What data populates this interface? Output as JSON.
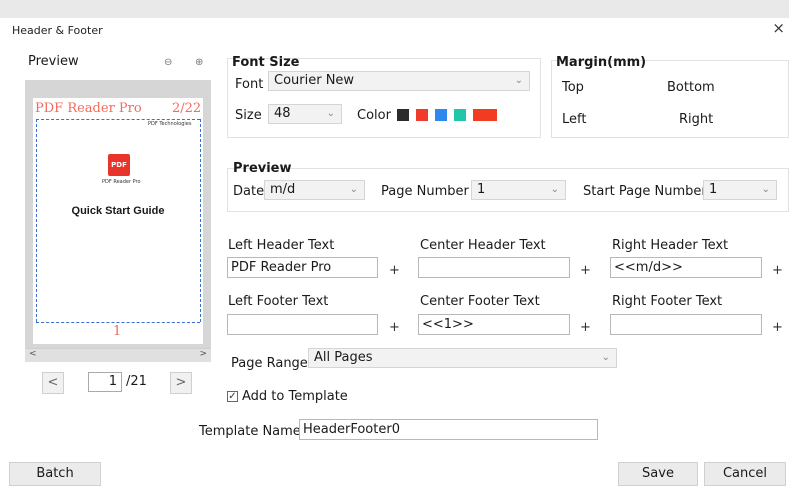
{
  "window": {
    "title": "Header & Footer",
    "close_glyph": "×"
  },
  "preview_panel": {
    "label": "Preview",
    "zoom_out_glyph": "⊖",
    "zoom_in_glyph": "⊕",
    "page_header_left": "PDF Reader Pro",
    "page_header_right": "2/22",
    "logo_text": "PDF",
    "logo_caption": "PDF Reader Pro",
    "brand_caption": "PDF Technologies",
    "document_title": "Quick Start Guide",
    "page_footer_center": "1",
    "scroll_left_glyph": "<",
    "scroll_right_glyph": ">",
    "prev_glyph": "<",
    "next_glyph": ">",
    "current_page": "1",
    "page_total": "/21"
  },
  "font_size": {
    "heading": "Font Size",
    "font_label": "Font",
    "font_value": "Courier New",
    "size_label": "Size",
    "size_value": "48",
    "color_label": "Color",
    "colors": [
      "#2b2b2b",
      "#ef3b2c",
      "#2f87f0",
      "#22c7a9",
      "#f23c22"
    ]
  },
  "margin": {
    "heading": "Margin(mm)",
    "top_label": "Top",
    "bottom_label": "Bottom",
    "left_label": "Left",
    "right_label": "Right"
  },
  "format": {
    "heading": "Preview",
    "date_label": "Date",
    "date_value": "m/d",
    "page_number_label": "Page Number",
    "page_number_value": "1",
    "start_page_label": "Start Page Number",
    "start_page_value": "1"
  },
  "texts": {
    "left_header_label": "Left Header Text",
    "left_header_value": "PDF Reader Pro",
    "center_header_label": "Center Header Text",
    "center_header_value": "",
    "right_header_label": "Right Header Text",
    "right_header_value": "<<m/d>>",
    "left_footer_label": "Left Footer Text",
    "left_footer_value": "",
    "center_footer_label": "Center Footer Text",
    "center_footer_value": "<<1>>",
    "right_footer_label": "Right Footer Text",
    "right_footer_value": "",
    "plus_glyph": "+"
  },
  "page_range": {
    "label": "Page Range",
    "value": "All Pages"
  },
  "template": {
    "add_label": "Add to Template",
    "add_checked_glyph": "✓",
    "name_label": "Template Name",
    "name_value": "HeaderFooter0"
  },
  "buttons": {
    "batch": "Batch",
    "save": "Save",
    "cancel": "Cancel"
  },
  "caret_glyph": "⌄"
}
